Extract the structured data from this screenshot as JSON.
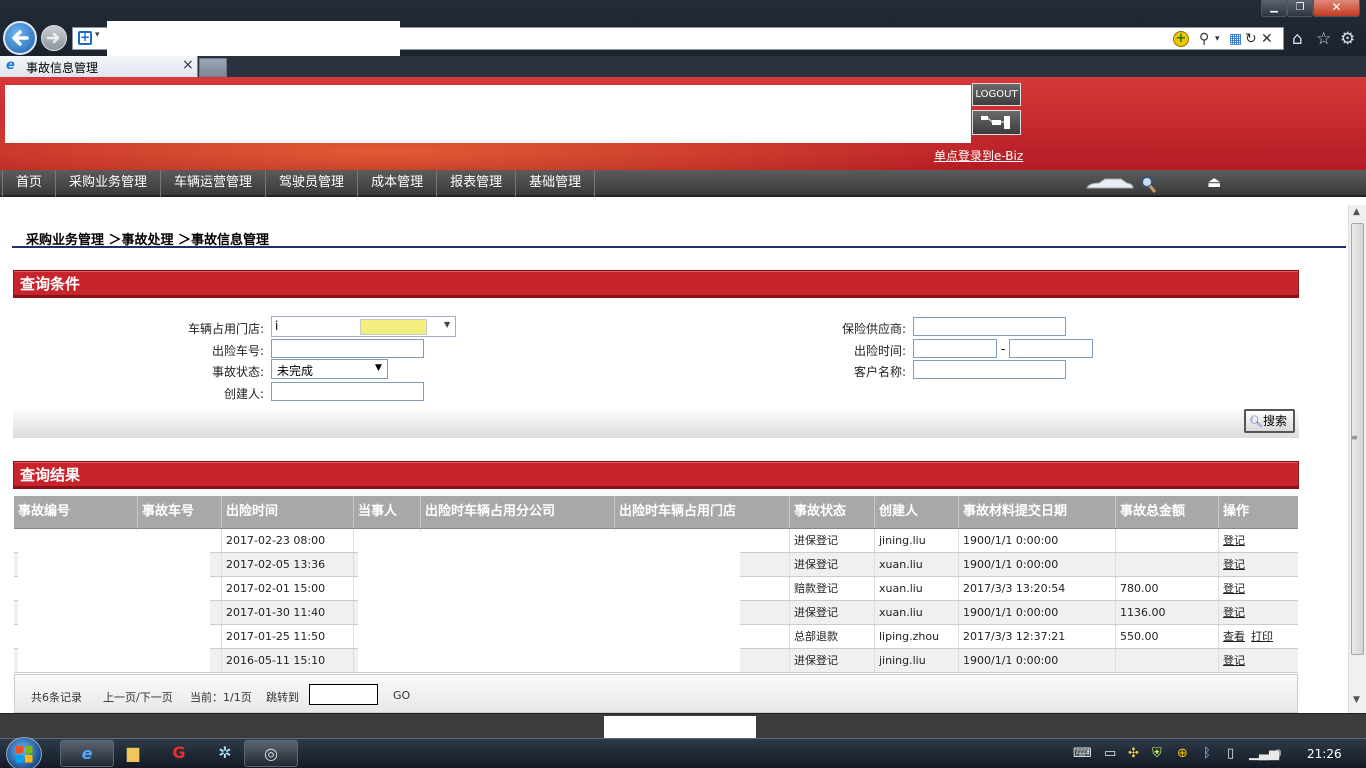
{
  "browser": {
    "tab_title": "事故信息管理",
    "tab_close": "×",
    "window_buttons": {
      "minimize": "▁",
      "maximize": "❐",
      "close": "✕"
    }
  },
  "header": {
    "logout_label": "LOGOUT",
    "sso_link": "单点登录到e-Biz"
  },
  "menu": {
    "items": [
      "首页",
      "采购业务管理",
      "车辆运营管理",
      "驾驶员管理",
      "成本管理",
      "报表管理",
      "基础管理"
    ]
  },
  "breadcrumb": "采购业务管理 ＞事故处理 ＞事故信息管理",
  "query": {
    "title": "查询条件",
    "labels": {
      "store": "车辆占用门店:",
      "plate": "出险车号:",
      "status": "事故状态:",
      "creator": "创建人:",
      "insurer": "保险供应商:",
      "time": "出险时间:",
      "customer": "客户名称:"
    },
    "store_value": "i",
    "status_value": "未完成",
    "date_separator": "-",
    "search_button": "搜索"
  },
  "results": {
    "title": "查询结果",
    "columns": [
      "事故编号",
      "事故车号",
      "出险时间",
      "当事人",
      "出险时车辆占用分公司",
      "出险时车辆占用门店",
      "事故状态",
      "创建人",
      "事故材料提交日期",
      "事故总金额",
      "操作"
    ],
    "rows": [
      {
        "time": "2017-02-23 08:00",
        "status": "进保登记",
        "creator": "jining.liu",
        "submit_date": "1900/1/1 0:00:00",
        "amount": "",
        "actions": [
          "登记"
        ]
      },
      {
        "time": "2017-02-05 13:36",
        "status": "进保登记",
        "creator": "xuan.liu",
        "submit_date": "1900/1/1 0:00:00",
        "amount": "",
        "actions": [
          "登记"
        ]
      },
      {
        "time": "2017-02-01 15:00",
        "status": "赔款登记",
        "creator": "xuan.liu",
        "submit_date": "2017/3/3 13:20:54",
        "amount": "780.00",
        "actions": [
          "登记"
        ]
      },
      {
        "time": "2017-01-30 11:40",
        "status": "进保登记",
        "creator": "xuan.liu",
        "submit_date": "1900/1/1 0:00:00",
        "amount": "1136.00",
        "actions": [
          "登记"
        ]
      },
      {
        "time": "2017-01-25 11:50",
        "status": "总部退款",
        "creator": "liping.zhou",
        "submit_date": "2017/3/3 12:37:21",
        "amount": "550.00",
        "actions": [
          "查看",
          "打印"
        ]
      },
      {
        "time": "2016-05-11 15:10",
        "status": "进保登记",
        "creator": "jining.liu",
        "submit_date": "1900/1/1 0:00:00",
        "amount": "",
        "actions": [
          "登记"
        ]
      }
    ]
  },
  "pager": {
    "total": "共6条记录",
    "prev_next": "上一页/下一页",
    "current": "当前：1/1页",
    "jump": "跳转到",
    "go": "GO"
  },
  "taskbar": {
    "clock": "21:26"
  },
  "colors": {
    "header_red": "#c8242c",
    "menu_dark": "#444444",
    "table_header_gray": "#a8a8a8"
  }
}
